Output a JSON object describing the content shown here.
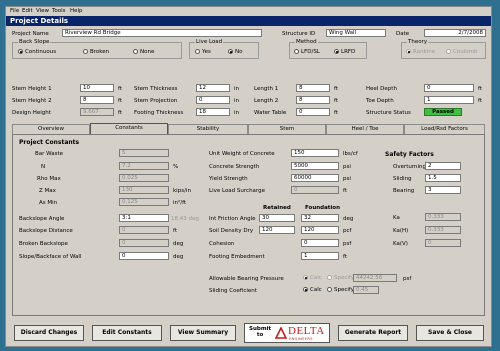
{
  "menu": [
    "File",
    "Edit",
    "View",
    "Tools",
    "Help"
  ],
  "title": "Project Details",
  "header": {
    "project_name_label": "Project Name",
    "project_name": "Riverview Rd Bridge",
    "structure_id_label": "Structure ID",
    "structure_id": "Wing Wall",
    "date_label": "Date",
    "date": "2/7/2008"
  },
  "back_slope": {
    "label": "Back Slope",
    "options": [
      "Continuous",
      "Broken",
      "None"
    ],
    "selected": "Continuous"
  },
  "live_load": {
    "label": "Live Load",
    "options": [
      "Yes",
      "No"
    ],
    "selected": "No"
  },
  "method": {
    "label": "Method",
    "options": [
      "LFD/SL",
      "LRFD"
    ],
    "selected": "LRFD"
  },
  "theory": {
    "label": "Theory",
    "options": [
      "Rankine",
      "Coulomb"
    ],
    "selected": "Rankine"
  },
  "dims": {
    "stem_height_1_label": "Stem Height 1",
    "stem_height_1": "10",
    "stem_height_1_unit": "ft",
    "stem_height_2_label": "Stem Height 2",
    "stem_height_2": "8",
    "stem_height_2_unit": "ft",
    "design_height_label": "Design Height",
    "design_height": "9.667",
    "design_height_unit": "ft",
    "stem_thickness_label": "Stem Thickness",
    "stem_thickness": "12",
    "stem_thickness_unit": "in",
    "stem_projection_label": "Stem Projection",
    "stem_projection": "0",
    "stem_projection_unit": "in",
    "footing_thickness_label": "Footing Thickness",
    "footing_thickness": "18",
    "footing_thickness_unit": "in",
    "length_1_label": "Length 1",
    "length_1": "8",
    "length_1_unit": "ft",
    "length_2_label": "Length 2",
    "length_2": "8",
    "length_2_unit": "ft",
    "water_table_label": "Water Table",
    "water_table": "0",
    "water_table_unit": "ft",
    "heel_depth_label": "Heel Depth",
    "heel_depth": "0",
    "heel_depth_unit": "ft",
    "toe_depth_label": "Toe Depth",
    "toe_depth": "1",
    "toe_depth_unit": "ft",
    "structure_status_label": "Structure Status",
    "structure_status": "Passed"
  },
  "tabs": [
    "Overview",
    "Constants",
    "Stability",
    "Stem",
    "Heel / Toe",
    "Load/Rsd Factors"
  ],
  "active_tab": "Constants",
  "project_constants": {
    "heading": "Project Constants",
    "rows": [
      {
        "label": "Bar Waste",
        "value": "5",
        "unit": ""
      },
      {
        "label": "N",
        "value": "7.2",
        "unit": "%"
      },
      {
        "label": "Rho Max",
        "value": "0.025",
        "unit": ""
      },
      {
        "label": "Z Max",
        "value": "130",
        "unit": "kips/in"
      },
      {
        "label": "As Min",
        "value": "0.125",
        "unit": "in²/ft"
      }
    ],
    "backslope_angle_label": "Backslope Angle",
    "backslope_angle": "3:1",
    "backslope_angle_deg": "18.43 deg",
    "backslope_distance_label": "Backslope Distance",
    "backslope_distance": "0",
    "backslope_distance_unit": "ft",
    "broken_backslope_label": "Broken Backslope",
    "broken_backslope": "0",
    "broken_backslope_unit": "deg",
    "slope_backface_label": "Slope/Backface of Wall",
    "slope_backface": "0",
    "slope_backface_unit": "deg"
  },
  "concrete": {
    "unit_weight_label": "Unit Weight of Concrete",
    "unit_weight": "150",
    "unit_weight_unit": "lbs/cf",
    "concrete_strength_label": "Concrete Strength",
    "concrete_strength": "5000",
    "concrete_strength_unit": "psi",
    "yield_strength_label": "Yield Strength",
    "yield_strength": "60000",
    "yield_strength_unit": "psi",
    "live_load_surcharge_label": "Live Load Surcharge",
    "live_load_surcharge": "0",
    "live_load_surcharge_unit": "ft"
  },
  "soil": {
    "retained_label": "Retained",
    "foundation_label": "Foundation",
    "friction_angle_label": "Int Friction Angle",
    "friction_retained": "30",
    "friction_foundation": "32",
    "friction_unit": "deg",
    "density_label": "Soil Density Dry",
    "density_retained": "120",
    "density_foundation": "120",
    "density_unit": "pcf",
    "cohesion_label": "Cohesion",
    "cohesion": "0",
    "cohesion_unit": "psf",
    "embedment_label": "Footing Embedment",
    "embedment": "1",
    "embedment_unit": "ft"
  },
  "safety": {
    "heading": "Safety Factors",
    "overturning_label": "Overturning",
    "overturning": "2",
    "sliding_label": "Sliding",
    "sliding": "1.5",
    "bearing_label": "Bearing",
    "bearing": "3",
    "ka_label": "Ka",
    "ka": "0.333",
    "kah_label": "Ka(H)",
    "kah": "0.333",
    "kav_label": "Ka(V)",
    "kav": "0"
  },
  "bearing": {
    "pressure_label": "Allowable Bearing Pressure",
    "pressure_options": [
      "Calc",
      "Specify"
    ],
    "pressure_selected": "Calc",
    "pressure_value": "44242.56",
    "pressure_unit": "psf",
    "sliding_label": "Sliding Coeficient",
    "sliding_options": [
      "Calc",
      "Specify"
    ],
    "sliding_selected": "Calc",
    "sliding_value": "0.45"
  },
  "buttons": {
    "discard": "Discard Changes",
    "edit_constants": "Edit Constants",
    "view_summary": "View Summary",
    "submit_line1": "Submit",
    "submit_line2": "to",
    "delta_logo": "DELTA",
    "delta_sub": "ENGINEERS",
    "generate": "Generate Report",
    "save_close": "Save & Close"
  }
}
